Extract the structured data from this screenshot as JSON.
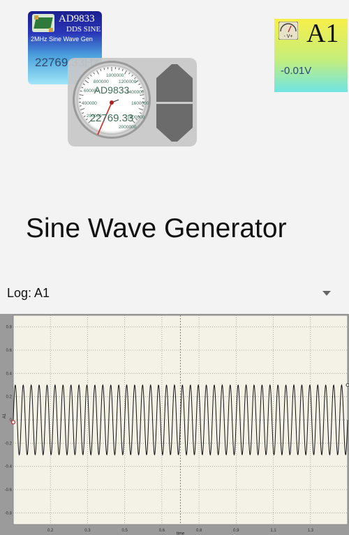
{
  "widgets": {
    "ad9833": {
      "title": "AD9833",
      "subtitle": "DDS SINE",
      "description": "2MHz Sine Wave Gen",
      "frequency": "22769.33Hz",
      "icon": "pcb-board-icon"
    },
    "meter": {
      "dial_label": "AD9833",
      "dial_value": "22769.33",
      "scale": [
        "400000",
        "600000",
        "800000",
        "1000000",
        "1200000",
        "1400000",
        "1600000",
        "1800000",
        "2000000",
        "200000"
      ],
      "up_icon": "arrow-up-icon",
      "down_icon": "arrow-down-icon"
    },
    "a1": {
      "label": "A1",
      "value": "-0.01V",
      "icon": "voltmeter-icon",
      "icon_text": "- V+"
    }
  },
  "page": {
    "title": "Sine Wave Generator"
  },
  "log_select": {
    "selected": "Log: A1"
  },
  "chart_data": {
    "type": "line",
    "ylabel": "A1",
    "xlabel": "time",
    "xlim": [
      0,
      1.5
    ],
    "ylim": [
      -0.9,
      0.9
    ],
    "xticks": [
      "0.2",
      "0.3",
      "0.5",
      "0.6",
      "0.8",
      "0.9",
      "1.1",
      "1.3"
    ],
    "yticks": [
      "0.8",
      "0.6",
      "0.4",
      "0.2",
      "0",
      "-0.2",
      "-0.4",
      "-0.6",
      "-0.8"
    ],
    "grid": true,
    "series": [
      {
        "amplitude": 0.3,
        "cycles": 42,
        "color": "#111111"
      }
    ]
  },
  "colors": {
    "accent": "#2b4a6e",
    "chart_bg": "#f4f1e6"
  }
}
